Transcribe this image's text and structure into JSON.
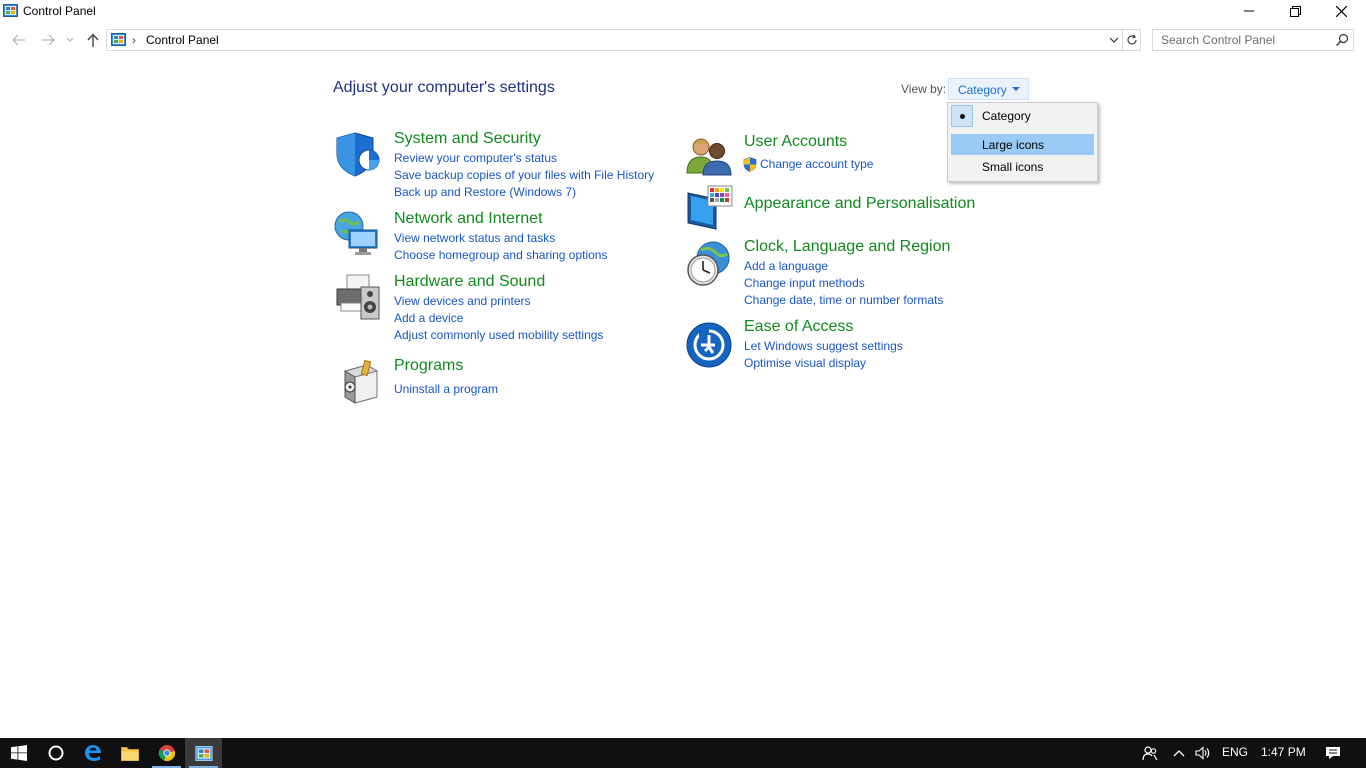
{
  "window": {
    "title": "Control Panel"
  },
  "address_bar": {
    "breadcrumb": "Control Panel",
    "separator": "›"
  },
  "search": {
    "placeholder": "Search Control Panel"
  },
  "main": {
    "heading": "Adjust your computer's settings",
    "view_by_label": "View by:",
    "view_by_value": "Category"
  },
  "view_by_menu": {
    "items": [
      {
        "label": "Category",
        "checked": true
      },
      {
        "label": "Large icons",
        "highlighted": true
      },
      {
        "label": "Small icons"
      }
    ]
  },
  "categories": {
    "system_security": {
      "title": "System and Security",
      "icon": "shield-icon",
      "links": [
        "Review your computer's status",
        "Save backup copies of your files with File History",
        "Back up and Restore (Windows 7)"
      ]
    },
    "network": {
      "title": "Network and Internet",
      "icon": "network-globe-icon",
      "links": [
        "View network status and tasks",
        "Choose homegroup and sharing options"
      ]
    },
    "hardware": {
      "title": "Hardware and Sound",
      "icon": "printer-speaker-icon",
      "links": [
        "View devices and printers",
        "Add a device",
        "Adjust commonly used mobility settings"
      ]
    },
    "programs": {
      "title": "Programs",
      "icon": "programs-box-icon",
      "links": [
        "Uninstall a program"
      ]
    },
    "user_accounts": {
      "title": "User Accounts",
      "icon": "users-icon",
      "links": [
        "Change account type"
      ]
    },
    "appearance": {
      "title": "Appearance and Personalisation",
      "icon": "monitor-palette-icon",
      "links": []
    },
    "clock": {
      "title": "Clock, Language and Region",
      "icon": "clock-globe-icon",
      "links": [
        "Add a language",
        "Change input methods",
        "Change date, time or number formats"
      ]
    },
    "ease": {
      "title": "Ease of Access",
      "icon": "ease-of-access-icon",
      "links": [
        "Let Windows suggest settings",
        "Optimise visual display"
      ]
    }
  },
  "taskbar": {
    "language": "ENG",
    "time": "1:47 PM"
  },
  "colors": {
    "link": "#1a56c8",
    "category_title": "#118a1d",
    "heading": "#1e3287",
    "menu_highlight": "#99cbf5",
    "taskbar": "#101010"
  }
}
